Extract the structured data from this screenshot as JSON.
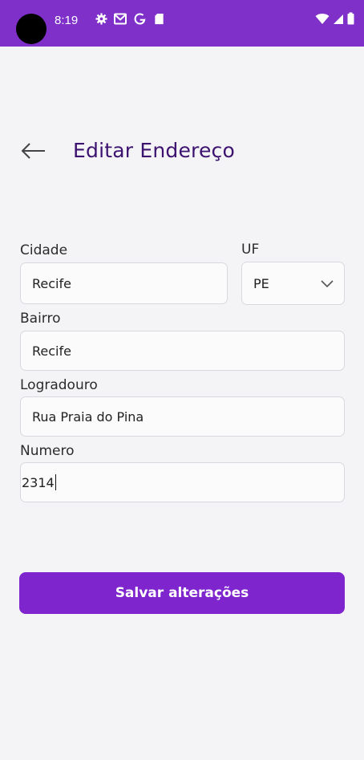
{
  "status_bar": {
    "time": "8:19",
    "icons": [
      "settings-icon",
      "gmail-icon",
      "google-icon",
      "sd-card-icon",
      "wifi-icon",
      "signal-icon",
      "battery-icon"
    ],
    "background": "#7f30c9"
  },
  "header": {
    "title": "Editar Endereço",
    "title_color": "#3d1370"
  },
  "form": {
    "cidade_label": "Cidade",
    "cidade_value": "Recife",
    "uf_label": "UF",
    "uf_value": "PE",
    "bairro_label": "Bairro",
    "bairro_value": "Recife",
    "logradouro_label": "Logradouro",
    "logradouro_value": "Rua Praia do Pina",
    "numero_label": "Numero",
    "numero_value": "2314"
  },
  "actions": {
    "save_label": "Salvar alterações",
    "accent": "#7f25ce"
  }
}
